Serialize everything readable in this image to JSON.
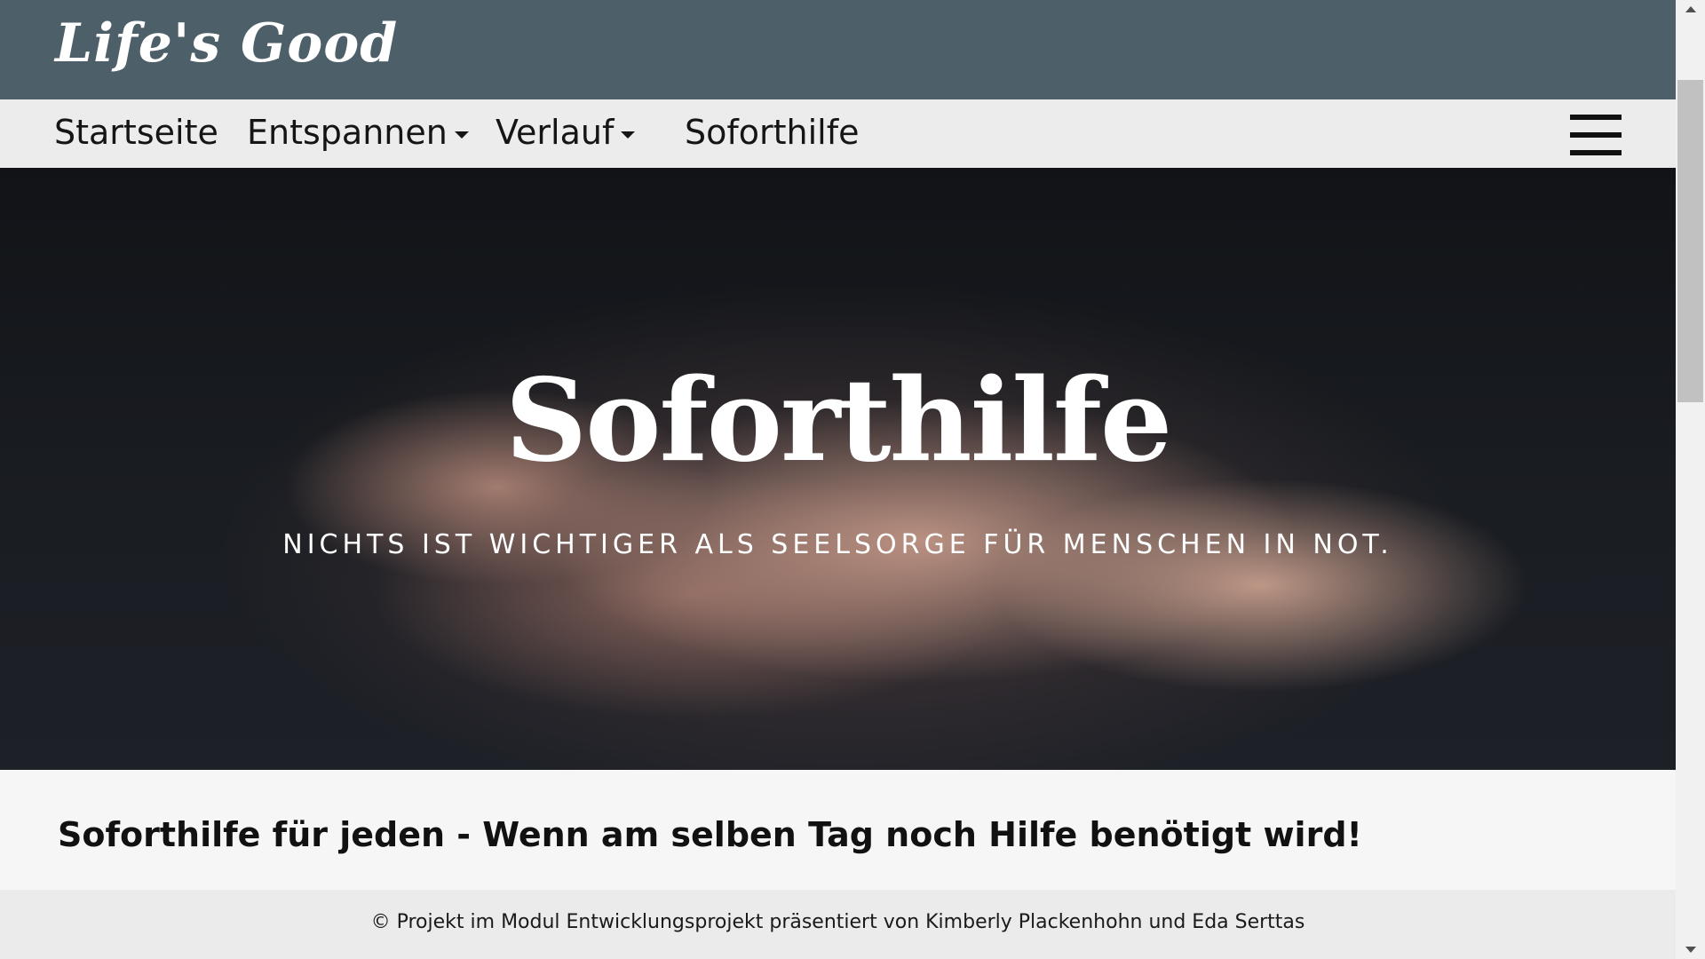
{
  "header": {
    "logo": "Life's Good"
  },
  "nav": {
    "items": [
      {
        "label": "Startseite",
        "has_dropdown": false
      },
      {
        "label": "Entspannen",
        "has_dropdown": true
      },
      {
        "label": "Verlauf",
        "has_dropdown": true
      },
      {
        "label": "Soforthilfe",
        "has_dropdown": false
      }
    ],
    "menu_icon": "hamburger-menu-icon"
  },
  "hero": {
    "title": "Soforthilfe",
    "subtitle": "NICHTS IST WICHTIGER ALS SEELSORGE FÜR MENSCHEN IN NOT."
  },
  "content": {
    "heading": "Soforthilfe für jeden - Wenn am selben Tag noch Hilfe benötigt wird!"
  },
  "footer": {
    "text": "© Projekt im Modul Entwicklungsprojekt präsentiert von Kimberly Plackenhohn und Eda Serttas"
  },
  "colors": {
    "brand_bar": "#4d5f68",
    "nav_bar": "#ececec",
    "footer_bg": "#ebebeb"
  }
}
